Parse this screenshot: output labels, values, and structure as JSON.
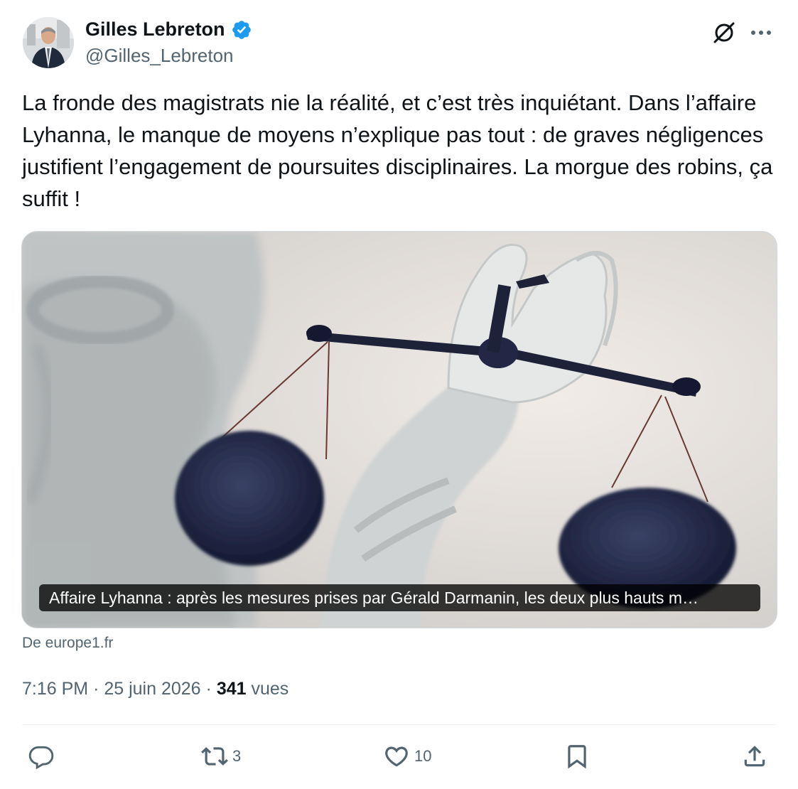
{
  "author": {
    "name": "Gilles Lebreton",
    "handle": "@Gilles_Lebreton",
    "verified": true,
    "verified_color": "#1d9bf0"
  },
  "header_icons": {
    "grok": "grok-icon",
    "more": "more-icon"
  },
  "tweet": {
    "text": "La fronde des magistrats nie la réalité, et c’est très inquiétant. Dans l’affaire Lyhanna, le manque de moyens n’explique pas tout : de graves négligences justifient l’engagement de poursuites disciplinaires. La morgue des robins, ça suffit !"
  },
  "card": {
    "caption": "Affaire Lyhanna : après les mesures prises par Gérald Darmanin, les deux plus hauts m…",
    "source": "De europe1.fr",
    "image_subject": "statue hand holding scales of justice"
  },
  "meta": {
    "time": "7:16 PM",
    "separator": "·",
    "date": "25 juin 2026",
    "views_count": "341",
    "views_label": "vues"
  },
  "actions": {
    "reply_count": "",
    "retweet_count": "3",
    "like_count": "10",
    "icon_color": "#536471"
  }
}
